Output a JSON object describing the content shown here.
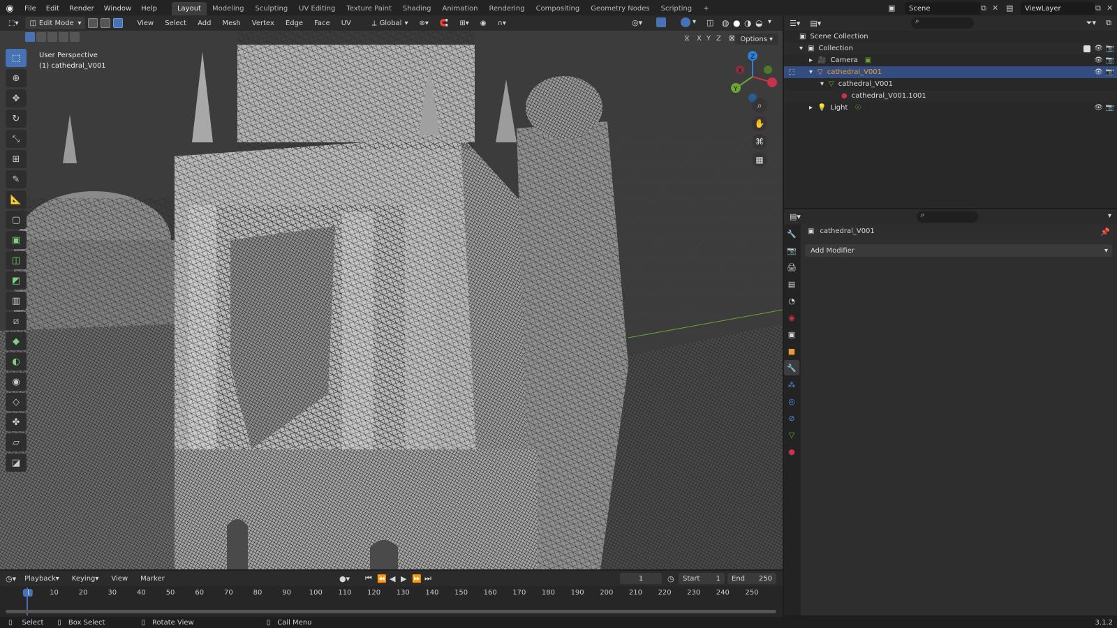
{
  "topbar": {
    "menus": [
      "File",
      "Edit",
      "Render",
      "Window",
      "Help"
    ],
    "workspaces": [
      "Layout",
      "Modeling",
      "Sculpting",
      "UV Editing",
      "Texture Paint",
      "Shading",
      "Animation",
      "Rendering",
      "Compositing",
      "Geometry Nodes",
      "Scripting"
    ],
    "active_workspace": "Layout",
    "add_tab": "+",
    "scene": "Scene",
    "view_layer": "ViewLayer"
  },
  "viewport_header": {
    "mode": "Edit Mode",
    "menus": [
      "View",
      "Select",
      "Add",
      "Mesh",
      "Vertex",
      "Edge",
      "Face",
      "UV"
    ],
    "orientation": "Global",
    "options": "Options",
    "axes": [
      "X",
      "Y",
      "Z"
    ]
  },
  "viewport": {
    "perspective_label": "User Perspective",
    "object_label": "(1) cathedral_V001",
    "tools": [
      "select-box",
      "cursor",
      "move",
      "rotate",
      "scale",
      "transform",
      "annotate",
      "measure",
      "add-cube",
      "extrude",
      "inset",
      "bevel",
      "loop-cut",
      "knife",
      "poly-build",
      "spin",
      "smooth",
      "edge-slide",
      "shrink-fatten",
      "shear",
      "rip"
    ]
  },
  "timeline": {
    "menus": [
      "Playback",
      "Keying",
      "View",
      "Marker"
    ],
    "current_frame": "1",
    "start_label": "Start",
    "start": "1",
    "end_label": "End",
    "end": "250",
    "frame_marks": [
      "1",
      "10",
      "20",
      "30",
      "40",
      "50",
      "60",
      "70",
      "80",
      "90",
      "100",
      "110",
      "120",
      "130",
      "140",
      "150",
      "160",
      "170",
      "180",
      "190",
      "200",
      "210",
      "220",
      "230",
      "240",
      "250"
    ]
  },
  "statusbar": {
    "items": [
      "Select",
      "Box Select",
      "Rotate View",
      "Call Menu"
    ],
    "version": "3.1.2"
  },
  "outliner": {
    "rows": [
      {
        "label": "Scene Collection",
        "icon": "scene-collection-icon"
      },
      {
        "label": "Collection",
        "icon": "collection-icon"
      },
      {
        "label": "Camera",
        "icon": "camera-icon"
      },
      {
        "label": "cathedral_V001",
        "icon": "mesh-object-icon"
      },
      {
        "label": "cathedral_V001",
        "icon": "mesh-data-icon"
      },
      {
        "label": "cathedral_V001.1001",
        "icon": "material-icon"
      },
      {
        "label": "Light",
        "icon": "light-icon"
      }
    ]
  },
  "properties": {
    "object_name": "cathedral_V001",
    "add_modifier": "Add Modifier"
  },
  "colors": {
    "accent": "#4772b3",
    "selection": "#334d80",
    "x_axis": "#c8324a",
    "y_axis": "#6ba832",
    "z_axis": "#2f7fd6",
    "object_orange": "#e99a3a"
  }
}
